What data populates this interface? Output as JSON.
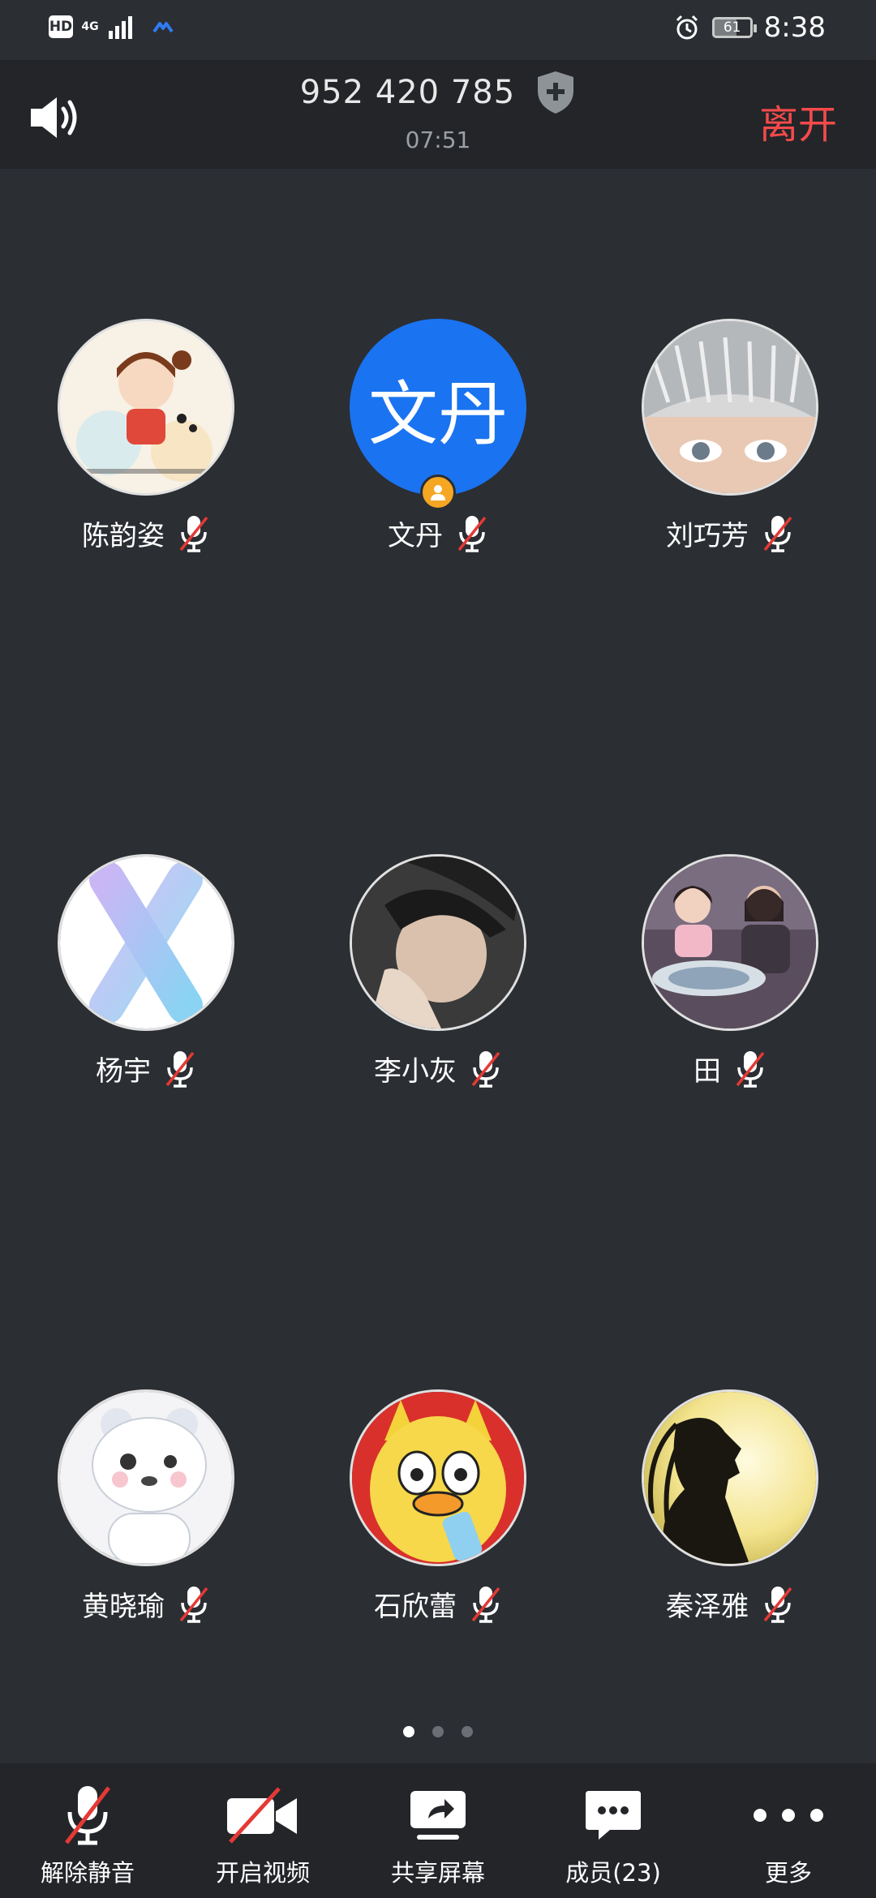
{
  "status_bar": {
    "hd": "HD",
    "network": "4G",
    "battery": "61",
    "time": "8:38"
  },
  "header": {
    "meeting_id": "952 420 785",
    "duration": "07:51",
    "leave_label": "离开"
  },
  "participants": [
    {
      "name": "陈韵姿",
      "avatar_icon": "cartoon-girl-avatar",
      "muted": true
    },
    {
      "name": "文丹",
      "avatar_text": "文丹",
      "avatar_color": "#1a73f0",
      "host": true,
      "muted": true
    },
    {
      "name": "刘巧芳",
      "avatar_icon": "headdress-portrait-avatar",
      "muted": true
    },
    {
      "name": "杨宇",
      "avatar_icon": "gradient-x-avatar",
      "muted": true
    },
    {
      "name": "李小灰",
      "avatar_icon": "person-photo-avatar",
      "muted": true
    },
    {
      "name": "田",
      "avatar_icon": "family-photo-avatar",
      "muted": true
    },
    {
      "name": "黄晓瑜",
      "avatar_icon": "bear-cartoon-avatar",
      "muted": true
    },
    {
      "name": "石欣蕾",
      "avatar_icon": "duck-cartoon-avatar",
      "muted": true
    },
    {
      "name": "秦泽雅",
      "avatar_icon": "silhouette-avatar",
      "muted": true
    }
  ],
  "pager": {
    "pages": 3,
    "current": 1
  },
  "toolbar": {
    "unmute": "解除静音",
    "video": "开启视频",
    "share": "共享屏幕",
    "members": "成员(23)",
    "more": "更多"
  },
  "colors": {
    "background": "#2b2e33",
    "header_bg": "#232529",
    "leave": "#f44a4a",
    "host_badge": "#f5a623",
    "mute_slash": "#e53935"
  }
}
